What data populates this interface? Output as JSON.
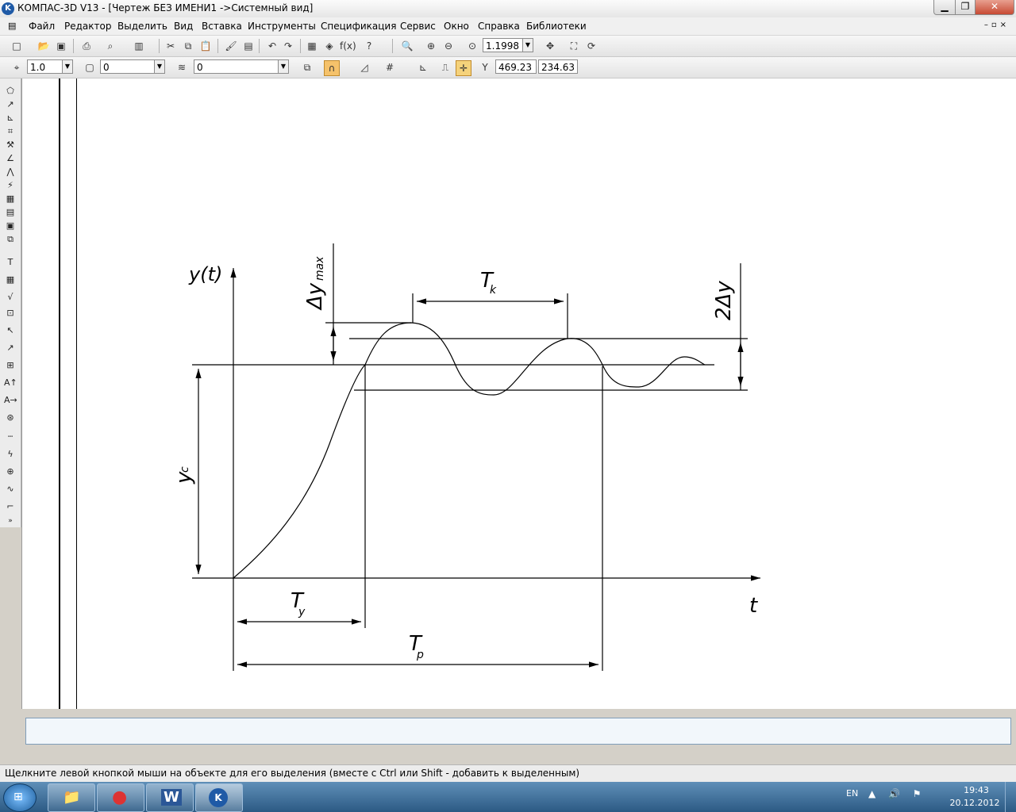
{
  "window": {
    "title": "КОМПАС-3D V13 - [Чертеж БЕЗ ИМЕНИ1 ->Системный вид]",
    "min": "▁",
    "max": "❐",
    "close": "✕"
  },
  "menu": [
    "Файл",
    "Редактор",
    "Выделить",
    "Вид",
    "Вставка",
    "Инструменты",
    "Спецификация",
    "Сервис",
    "Окно",
    "Справка",
    "Библиотеки"
  ],
  "mdi_controls": "–▫×",
  "toolbar1": {
    "zoom_value": "1.1998"
  },
  "toolbar2": {
    "line_width": "1.0",
    "style_value": "0",
    "layer_value": "0",
    "coord_x": "469.23",
    "coord_y": "234.63"
  },
  "drawing": {
    "labels": {
      "y_axis": "y(t)",
      "x_axis": "t",
      "delta_y_max": "Δy",
      "delta_y_max_sub": "max",
      "Tk": "T",
      "Tk_sub": "k",
      "two_delta_y": "2Δy",
      "yc": "y",
      "yc_sub": "c",
      "Ty": "T",
      "Ty_sub": "y",
      "Tp": "T",
      "Tp_sub": "p"
    }
  },
  "status": {
    "hint": "Щелкните левой кнопкой мыши на объекте для его выделения (вместе с Ctrl или Shift - добавить к выделенным)"
  },
  "taskbar": {
    "lang": "EN",
    "time": "19:43",
    "date": "20.12.2012",
    "tray_icons": "▲ 🔊 ⚑"
  },
  "apps": [
    {
      "name": "explorer",
      "icon": "📁"
    },
    {
      "name": "chrome",
      "icon": "●"
    },
    {
      "name": "word",
      "icon": "W"
    },
    {
      "name": "kompas",
      "icon": "K"
    }
  ]
}
